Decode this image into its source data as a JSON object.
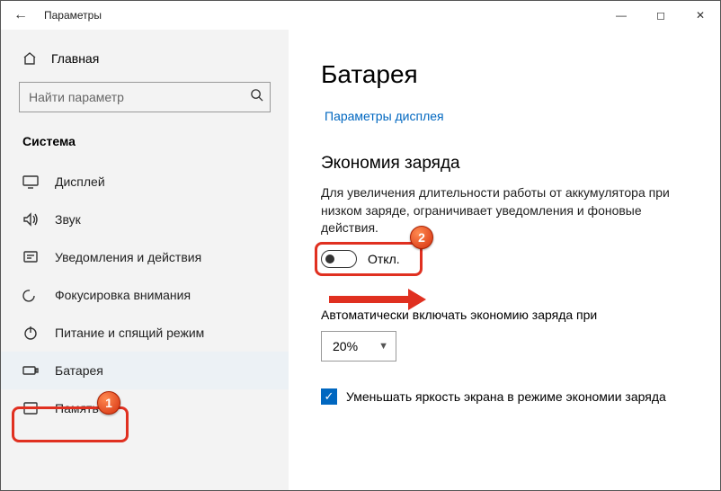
{
  "titlebar": {
    "title": "Параметры"
  },
  "sidebar": {
    "home": "Главная",
    "search_placeholder": "Найти параметр",
    "group": "Система",
    "items": [
      {
        "label": "Дисплей"
      },
      {
        "label": "Звук"
      },
      {
        "label": "Уведомления и действия"
      },
      {
        "label": "Фокусировка внимания"
      },
      {
        "label": "Питание и спящий режим"
      },
      {
        "label": "Батарея"
      },
      {
        "label": "Память"
      }
    ]
  },
  "main": {
    "title": "Батарея",
    "display_link": "Параметры дисплея",
    "section_title": "Экономия заряда",
    "desc": "Для увеличения длительности работы от аккумулятора при низком заряде, ограничивает уведомления и фоновые действия.",
    "toggle_label": "Откл.",
    "auto_label": "Автоматически включать экономию заряда при",
    "auto_value": "20%",
    "checkbox_label": "Уменьшать яркость экрана в режиме экономии заряда"
  },
  "annotations": {
    "badge1": "1",
    "badge2": "2"
  }
}
